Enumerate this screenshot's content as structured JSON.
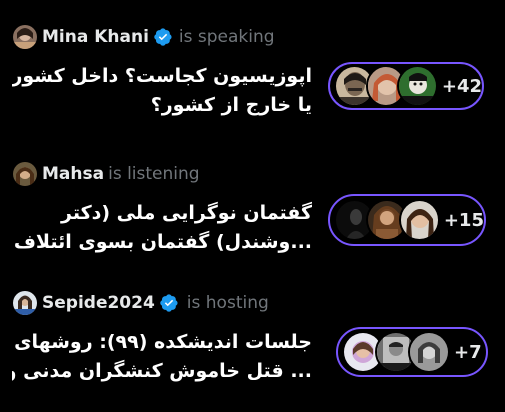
{
  "colors": {
    "background": "#000000",
    "accent": "#7856ff",
    "verified": "#1d9bf0",
    "muted": "#71767b",
    "text": "#e7e9ea"
  },
  "spaces": [
    {
      "host": {
        "name": "Mina Khani",
        "verified": true
      },
      "status": "is speaking",
      "title_lines": [
        "اپوزیسیون کجاست؟ داخل کشور",
        "یا خارج از کشور؟"
      ],
      "listener_count": "+42"
    },
    {
      "host": {
        "name": "Mahsa",
        "verified": false
      },
      "status": "is listening",
      "title_lines": [
        "گفتمان نوگرایی ملی (دکتر",
        "...وشندل)  گفتمان بسوی ائتلاف"
      ],
      "listener_count": "+15"
    },
    {
      "host": {
        "name": "Sepide2024",
        "verified": true
      },
      "status": "is hosting",
      "title_lines": [
        "جلسات اندیشکده (۹۹): روشهای",
        "... قتل خاموش کنشگران مدنی و"
      ],
      "listener_count": "+7"
    }
  ]
}
